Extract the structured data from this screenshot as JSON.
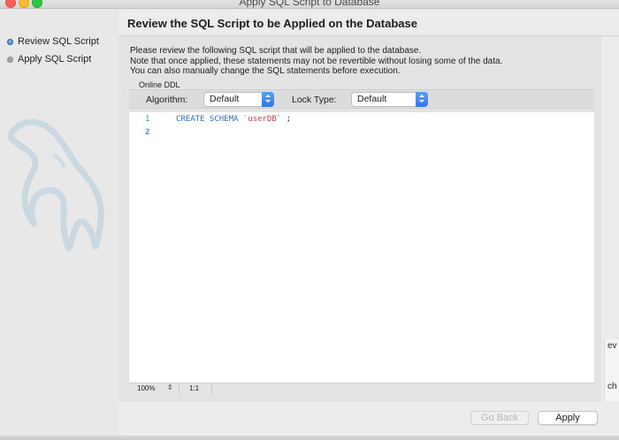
{
  "window": {
    "title": "Apply SQL Script to Database"
  },
  "steps": [
    {
      "label": "Review SQL Script",
      "state": "active"
    },
    {
      "label": "Apply SQL Script",
      "state": "pending"
    }
  ],
  "header": {
    "title": "Review the SQL Script to be Applied on the Database"
  },
  "description": {
    "line1": "Please review the following SQL script that will be applied to the database.",
    "line2": "Note that once applied, these statements may not be revertible without losing some of the data.",
    "line3": "You can also manually change the SQL statements before execution."
  },
  "online_ddl": {
    "section_label": "Online DDL",
    "algorithm_label": "Algorithm:",
    "algorithm_value": "Default",
    "lock_type_label": "Lock Type:",
    "lock_type_value": "Default"
  },
  "editor": {
    "lines": [
      {
        "number": "1",
        "keyword": "CREATE SCHEMA",
        "identifier": "`userDB`",
        "tail": " ;"
      },
      {
        "number": "2",
        "keyword": "",
        "identifier": "",
        "tail": ""
      }
    ],
    "zoom": "100%",
    "cursor_position": "1:1"
  },
  "buttons": {
    "go_back": "Go Back",
    "apply": "Apply"
  },
  "right_edge": {
    "text_top": "ev",
    "text_bottom": "ch"
  },
  "colors": {
    "accent_blue": "#2f76ea",
    "line_number": "#3b8fd3",
    "keyword": "#2a6fc9",
    "string": "#b04b4b"
  }
}
